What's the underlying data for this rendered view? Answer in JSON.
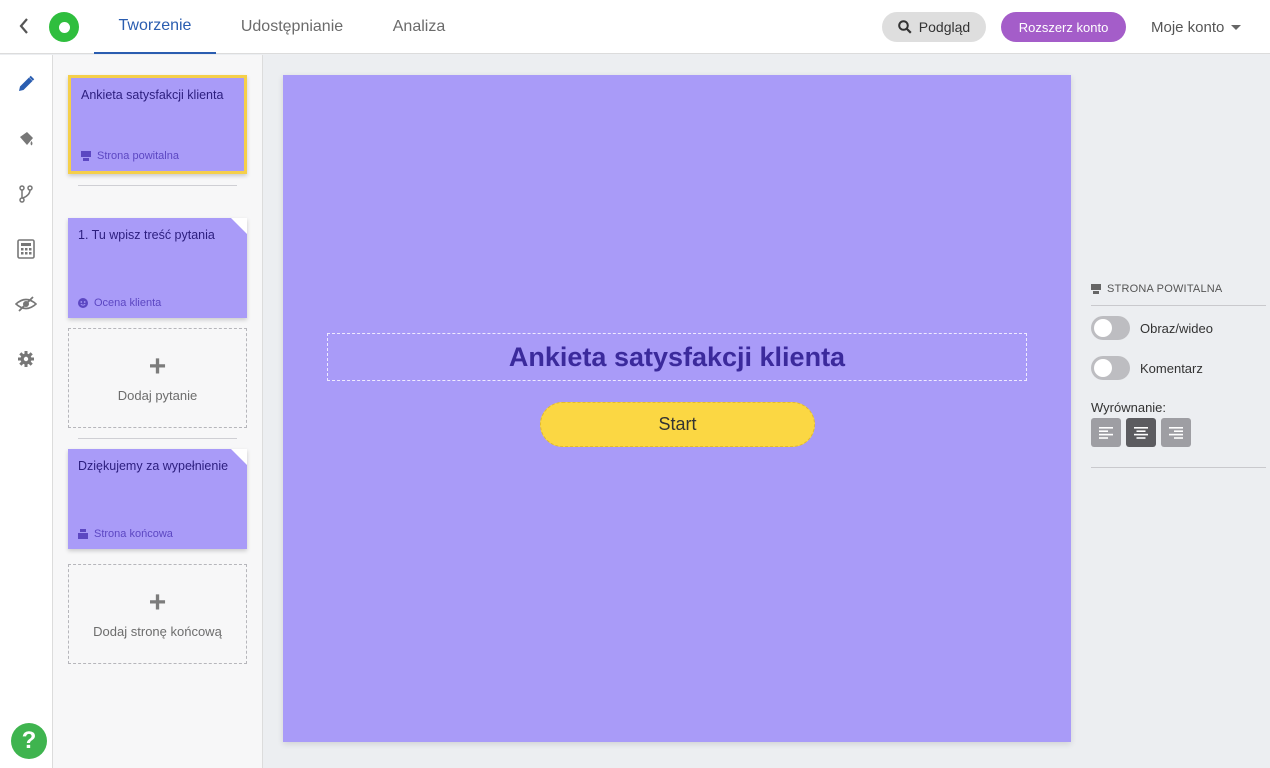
{
  "topbar": {
    "back_icon": "chevron-left-icon",
    "logo_icon": "survey-logo-icon",
    "tabs": [
      {
        "label": "Tworzenie",
        "active": true
      },
      {
        "label": "Udostępnianie",
        "active": false
      },
      {
        "label": "Analiza",
        "active": false
      }
    ],
    "preview_label": "Podgląd",
    "upgrade_label": "Rozszerz konto",
    "account_label": "Moje konto"
  },
  "rail": {
    "icons": [
      "pencil-icon",
      "paint-bucket-icon",
      "branch-icon",
      "calculator-icon",
      "hidden-eye-icon",
      "gear-icon"
    ],
    "help_label": "?"
  },
  "pages": {
    "welcome": {
      "title": "Ankieta satysfakcji klienta",
      "type": "Strona powitalna"
    },
    "question": {
      "title": "1. Tu wpisz treść pytania",
      "type": "Ocena klienta"
    },
    "add_question": "Dodaj pytanie",
    "ending": {
      "title": "Dziękujemy za wypełnienie",
      "type": "Strona końcowa"
    },
    "add_ending": "Dodaj stronę końcową"
  },
  "canvas": {
    "title": "Ankieta satysfakcji klienta",
    "start_label": "Start",
    "background": "#a99bf8",
    "button_color": "#fbd743"
  },
  "settings": {
    "section_title": "STRONA POWITALNA",
    "toggles": [
      {
        "label": "Obraz/wideo",
        "on": false
      },
      {
        "label": "Komentarz",
        "on": false
      }
    ],
    "alignment_label": "Wyrównanie:",
    "alignment": "center"
  },
  "colors": {
    "accent": "#2a5db0",
    "upgrade": "#a45dc9",
    "selected_border": "#f5cf4a"
  }
}
